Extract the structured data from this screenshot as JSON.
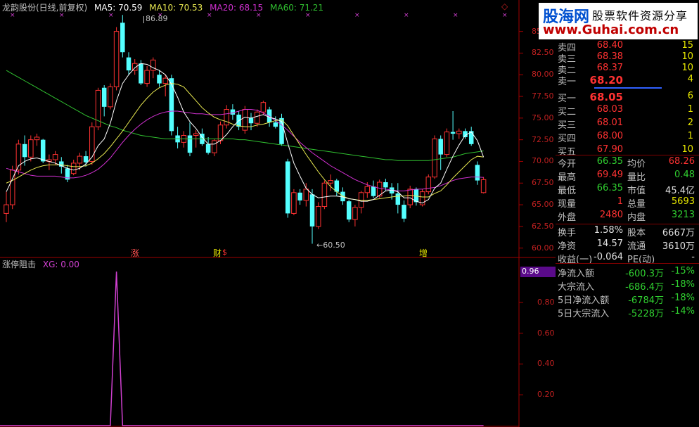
{
  "header": {
    "title": "龙韵股份(日线,前复权)",
    "ma5": "MA5: 70.59",
    "ma10": "MA10: 70.53",
    "ma20": "MA20: 68.15",
    "ma60": "MA60: 71.21"
  },
  "colors": {
    "up": "#ff3232",
    "down": "#54ffff",
    "ma5": "#ffffff",
    "ma10": "#e8e850",
    "ma20": "#d030d0",
    "ma60": "#30c030",
    "axis": "#c02020",
    "indicator": "#d040d0"
  },
  "price_axis": [
    "85.00",
    "82.50",
    "80.00",
    "77.50",
    "75.00",
    "72.50",
    "70.00",
    "67.50",
    "65.00",
    "62.50",
    "60.00"
  ],
  "annotations": {
    "high": "86.89",
    "low": "60.50"
  },
  "markers": [
    "涨",
    "财",
    "$",
    "增"
  ],
  "indicator": {
    "title": "涨停阻击",
    "xg": "XG: 0.00",
    "current": "0.96",
    "axis": [
      "0.80",
      "0.60",
      "0.40",
      "0.20"
    ]
  },
  "logo": {
    "brand": "股海网",
    "slogan": "股票软件资源分享",
    "url": "www.Guhai.com.cn"
  },
  "orderbook": {
    "asks": [
      {
        "label": "卖四",
        "price": "68.40",
        "vol": "15"
      },
      {
        "label": "卖三",
        "price": "68.38",
        "vol": "10"
      },
      {
        "label": "卖二",
        "price": "68.37",
        "vol": "10"
      },
      {
        "label": "卖一",
        "price": "68.20",
        "vol": "4"
      }
    ],
    "bids": [
      {
        "label": "买一",
        "price": "68.05",
        "vol": "6"
      },
      {
        "label": "买二",
        "price": "68.03",
        "vol": "1"
      },
      {
        "label": "买三",
        "price": "68.01",
        "vol": "2"
      },
      {
        "label": "买四",
        "price": "68.00",
        "vol": "1"
      },
      {
        "label": "买五",
        "price": "67.90",
        "vol": "10"
      }
    ]
  },
  "quote": [
    {
      "l1": "今开",
      "v1": "66.35",
      "l2": "均价",
      "v2": "68.26"
    },
    {
      "l1": "最高",
      "v1": "69.49",
      "l2": "量比",
      "v2": "0.48"
    },
    {
      "l1": "最低",
      "v1": "66.35",
      "l2": "市值",
      "v2": "45.4亿"
    },
    {
      "l1": "现量",
      "v1": "1",
      "l2": "总量",
      "v2": "5693"
    },
    {
      "l1": "外盘",
      "v1": "2480",
      "l2": "内盘",
      "v2": "3213"
    }
  ],
  "fundamentals": [
    {
      "l1": "换手",
      "v1": "1.58%",
      "l2": "股本",
      "v2": "6667万"
    },
    {
      "l1": "净资",
      "v1": "14.57",
      "l2": "流通",
      "v2": "3610万"
    },
    {
      "l1": "收益(一)",
      "v1": "-0.064",
      "l2": "PE(动)",
      "v2": "-"
    }
  ],
  "flows": [
    {
      "label": "净流入额",
      "value": "-600.3万",
      "pct": "-15%"
    },
    {
      "label": "大宗流入",
      "value": "-686.4万",
      "pct": "-18%"
    },
    {
      "label": "5日净流入额",
      "value": "-6784万",
      "pct": "-18%"
    },
    {
      "label": "5日大宗流入",
      "value": "-5228万",
      "pct": "-14%"
    }
  ],
  "chart_data": {
    "type": "candlestick",
    "ylim": [
      59,
      87
    ],
    "candles": [
      [
        64.0,
        66.5,
        63.0,
        65.0
      ],
      [
        65.0,
        69.5,
        64.5,
        69.0
      ],
      [
        69.0,
        72.5,
        68.5,
        72.0
      ],
      [
        72.0,
        73.0,
        69.5,
        70.5
      ],
      [
        70.5,
        73.0,
        70.0,
        72.5
      ],
      [
        72.5,
        73.2,
        71.8,
        72.8
      ],
      [
        72.5,
        72.6,
        69.8,
        70.0
      ],
      [
        70.0,
        70.8,
        69.0,
        70.2
      ],
      [
        70.2,
        71.2,
        69.6,
        70.8
      ],
      [
        70.0,
        70.5,
        68.6,
        69.4
      ],
      [
        69.2,
        69.6,
        67.6,
        67.9
      ],
      [
        68.6,
        70.2,
        68.4,
        69.8
      ],
      [
        69.8,
        71.0,
        69.0,
        70.6
      ],
      [
        70.6,
        71.2,
        69.4,
        69.9
      ],
      [
        70.0,
        74.5,
        69.6,
        74.0
      ],
      [
        74.0,
        78.5,
        73.6,
        78.2
      ],
      [
        78.5,
        78.8,
        75.2,
        76.3
      ],
      [
        76.3,
        79.0,
        76.0,
        78.6
      ],
      [
        78.6,
        85.5,
        78.2,
        85.0
      ],
      [
        86.0,
        86.9,
        82.0,
        82.6
      ],
      [
        82.0,
        82.6,
        80.0,
        80.5
      ],
      [
        80.5,
        81.8,
        80.0,
        81.3
      ],
      [
        81.3,
        81.7,
        78.8,
        79.0
      ],
      [
        79.0,
        81.0,
        78.6,
        80.5
      ],
      [
        80.5,
        82.0,
        79.6,
        81.7
      ],
      [
        80.0,
        80.5,
        78.6,
        79.0
      ],
      [
        79.0,
        80.0,
        77.5,
        79.6
      ],
      [
        79.6,
        80.0,
        73.0,
        73.5
      ],
      [
        73.0,
        74.0,
        71.5,
        72.2
      ],
      [
        72.2,
        73.5,
        71.6,
        73.0
      ],
      [
        73.0,
        74.5,
        70.6,
        71.0
      ],
      [
        73.0,
        73.6,
        71.6,
        73.2
      ],
      [
        73.2,
        73.8,
        71.8,
        72.0
      ],
      [
        72.0,
        72.8,
        70.8,
        71.0
      ],
      [
        71.0,
        72.6,
        70.6,
        72.4
      ],
      [
        72.4,
        74.6,
        72.0,
        74.2
      ],
      [
        74.2,
        76.5,
        73.8,
        76.0
      ],
      [
        76.0,
        76.6,
        74.8,
        75.4
      ],
      [
        75.4,
        75.8,
        73.6,
        74.0
      ],
      [
        73.6,
        76.4,
        73.2,
        76.0
      ],
      [
        75.0,
        75.6,
        73.6,
        74.4
      ],
      [
        74.4,
        76.0,
        74.0,
        75.7
      ],
      [
        75.7,
        77.0,
        75.4,
        76.8
      ],
      [
        76.0,
        76.3,
        74.0,
        74.5
      ],
      [
        74.5,
        75.2,
        73.8,
        74.0
      ],
      [
        75.0,
        75.5,
        71.8,
        72.0
      ],
      [
        70.0,
        70.3,
        63.5,
        64.0
      ],
      [
        64.0,
        66.8,
        63.8,
        66.4
      ],
      [
        66.4,
        66.8,
        65.0,
        65.5
      ],
      [
        65.5,
        67.5,
        64.8,
        66.8
      ],
      [
        66.2,
        66.8,
        60.5,
        62.5
      ],
      [
        62.5,
        65.3,
        62.2,
        64.8
      ],
      [
        64.8,
        67.8,
        64.5,
        67.5
      ],
      [
        67.5,
        68.5,
        66.6,
        67.8
      ],
      [
        67.8,
        68.0,
        66.0,
        66.5
      ],
      [
        66.5,
        67.0,
        65.0,
        65.4
      ],
      [
        65.4,
        65.6,
        63.0,
        63.3
      ],
      [
        63.3,
        65.0,
        62.5,
        64.7
      ],
      [
        64.7,
        66.6,
        64.0,
        66.4
      ],
      [
        66.4,
        67.6,
        65.8,
        67.1
      ],
      [
        67.1,
        67.8,
        65.8,
        66.0
      ],
      [
        66.0,
        67.9,
        65.8,
        67.6
      ],
      [
        67.6,
        68.0,
        66.6,
        67.0
      ],
      [
        67.0,
        67.5,
        65.6,
        66.3
      ],
      [
        66.3,
        67.5,
        64.0,
        65.0
      ],
      [
        65.0,
        65.5,
        63.0,
        63.4
      ],
      [
        65.0,
        67.2,
        64.6,
        66.8
      ],
      [
        66.8,
        67.0,
        64.9,
        65.3
      ],
      [
        65.0,
        66.8,
        64.8,
        66.5
      ],
      [
        66.5,
        68.5,
        66.2,
        68.2
      ],
      [
        68.2,
        73.0,
        68.0,
        72.6
      ],
      [
        72.6,
        73.0,
        69.0,
        70.8
      ],
      [
        70.8,
        73.8,
        70.5,
        73.4
      ],
      [
        73.4,
        75.8,
        72.5,
        73.2
      ],
      [
        73.2,
        73.8,
        72.6,
        73.5
      ],
      [
        73.5,
        73.8,
        72.6,
        72.8
      ],
      [
        73.5,
        74.0,
        71.8,
        72.0
      ],
      [
        69.6,
        70.0,
        67.3,
        67.8
      ],
      [
        66.4,
        68.2,
        66.3,
        67.9
      ]
    ],
    "ma": {
      "ma5": [
        66.5,
        68.0,
        69.5,
        70.0,
        70.3,
        70.4,
        70.2,
        70.0,
        69.8,
        69.5,
        69.2,
        69.0,
        69.2,
        69.7,
        70.5,
        71.8,
        72.6,
        74.4,
        77.0,
        79.0,
        80.0,
        80.8,
        81.3,
        81.2,
        80.8,
        80.5,
        80.0,
        78.9,
        77.4,
        75.7,
        74.6,
        73.8,
        72.8,
        72.0,
        72.0,
        72.4,
        73.1,
        74.0,
        74.7,
        75.1,
        75.0,
        75.2,
        75.4,
        75.1,
        74.9,
        74.6,
        72.1,
        69.8,
        68.3,
        66.9,
        66.2,
        65.8,
        65.9,
        66.0,
        66.0,
        65.9,
        65.7,
        65.6,
        65.4,
        65.4,
        65.6,
        66.1,
        66.6,
        66.7,
        66.5,
        65.8,
        65.8,
        65.4,
        65.2,
        65.6,
        66.9,
        67.5,
        69.1,
        70.6,
        71.9,
        73.0,
        73.4,
        72.4,
        70.5
      ],
      "ma10": [
        67.5,
        67.8,
        68.2,
        68.6,
        69.0,
        69.3,
        69.5,
        69.6,
        69.6,
        69.6,
        69.5,
        69.4,
        69.4,
        69.5,
        69.8,
        70.3,
        70.9,
        71.7,
        72.6,
        73.5,
        74.5,
        75.5,
        76.5,
        77.3,
        78.0,
        78.5,
        78.8,
        79.0,
        78.9,
        78.6,
        77.8,
        77.0,
        76.2,
        75.6,
        75.1,
        74.8,
        74.6,
        74.3,
        74.1,
        74.0,
        74.0,
        74.2,
        74.3,
        74.5,
        74.7,
        74.8,
        74.1,
        73.0,
        71.9,
        70.8,
        69.8,
        68.8,
        67.9,
        67.1,
        66.5,
        66.0,
        65.7,
        65.6,
        65.5,
        65.5,
        65.6,
        65.7,
        65.8,
        65.9,
        66.0,
        66.0,
        66.1,
        66.0,
        65.9,
        65.9,
        66.3,
        66.6,
        67.3,
        68.1,
        68.8,
        69.5,
        70.2,
        70.6,
        70.5
      ],
      "ma20": [
        69.2,
        69.0,
        68.8,
        68.6,
        68.4,
        68.3,
        68.3,
        68.3,
        68.3,
        68.2,
        68.1,
        68.1,
        68.2,
        68.4,
        68.7,
        69.1,
        69.7,
        70.4,
        71.3,
        72.2,
        73.0,
        73.7,
        74.3,
        74.8,
        75.2,
        75.5,
        75.7,
        75.8,
        75.8,
        75.7,
        75.6,
        75.5,
        75.5,
        75.4,
        75.4,
        75.4,
        75.5,
        75.6,
        75.8,
        76.0,
        76.0,
        75.9,
        75.6,
        75.2,
        74.7,
        74.2,
        73.6,
        72.9,
        72.2,
        71.6,
        71.0,
        70.5,
        70.0,
        69.5,
        69.1,
        68.7,
        68.3,
        67.9,
        67.6,
        67.3,
        67.1,
        66.9,
        66.8,
        66.7,
        66.6,
        66.6,
        66.7,
        66.8,
        66.8,
        66.9,
        67.0,
        67.2,
        67.5,
        67.8,
        68.0,
        68.1,
        68.2,
        68.2,
        68.15
      ],
      "ma60": [
        80.5,
        80.1,
        79.7,
        79.3,
        78.9,
        78.5,
        78.1,
        77.7,
        77.3,
        76.9,
        76.5,
        76.1,
        75.7,
        75.3,
        75.0,
        74.7,
        74.4,
        74.1,
        73.9,
        73.6,
        73.4,
        73.2,
        73.0,
        72.9,
        72.8,
        72.7,
        72.6,
        72.6,
        72.6,
        72.6,
        72.6,
        72.6,
        72.6,
        72.6,
        72.6,
        72.6,
        72.6,
        72.6,
        72.5,
        72.5,
        72.4,
        72.3,
        72.2,
        72.1,
        72.0,
        71.9,
        71.8,
        71.7,
        71.6,
        71.5,
        71.4,
        71.3,
        71.2,
        71.1,
        71.0,
        70.9,
        70.8,
        70.7,
        70.6,
        70.5,
        70.4,
        70.3,
        70.2,
        70.2,
        70.1,
        70.1,
        70.1,
        70.1,
        70.1,
        70.1,
        70.2,
        70.3,
        70.4,
        70.5,
        70.7,
        70.9,
        71.0,
        71.1,
        71.21
      ]
    },
    "indicator_series": {
      "ylim": [
        0,
        1.0
      ],
      "spike_index": 18,
      "spike_value": 1.0,
      "spike_start": 17,
      "spike_end": 19
    }
  }
}
